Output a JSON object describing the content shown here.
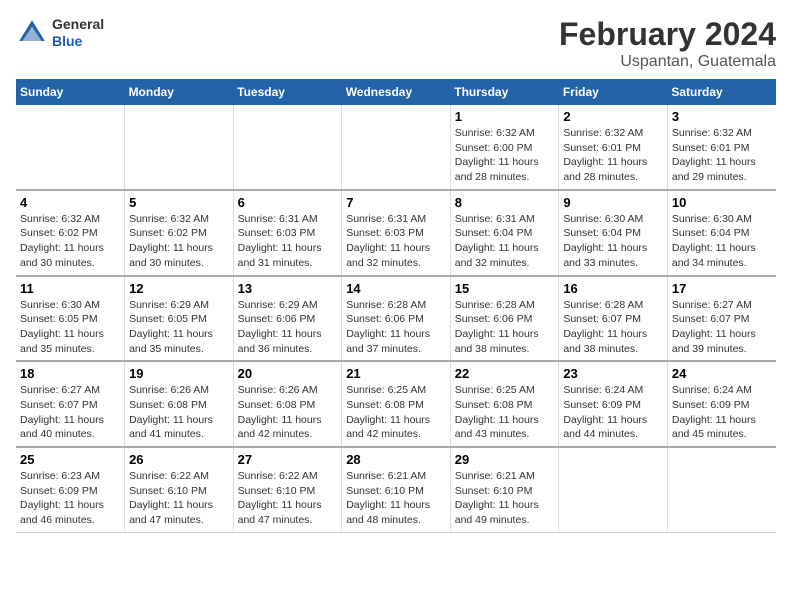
{
  "header": {
    "title": "February 2024",
    "subtitle": "Uspantan, Guatemala",
    "logo_general": "General",
    "logo_blue": "Blue"
  },
  "columns": [
    "Sunday",
    "Monday",
    "Tuesday",
    "Wednesday",
    "Thursday",
    "Friday",
    "Saturday"
  ],
  "weeks": [
    [
      {
        "day": "",
        "info": ""
      },
      {
        "day": "",
        "info": ""
      },
      {
        "day": "",
        "info": ""
      },
      {
        "day": "",
        "info": ""
      },
      {
        "day": "1",
        "info": "Sunrise: 6:32 AM\nSunset: 6:00 PM\nDaylight: 11 hours and 28 minutes."
      },
      {
        "day": "2",
        "info": "Sunrise: 6:32 AM\nSunset: 6:01 PM\nDaylight: 11 hours and 28 minutes."
      },
      {
        "day": "3",
        "info": "Sunrise: 6:32 AM\nSunset: 6:01 PM\nDaylight: 11 hours and 29 minutes."
      }
    ],
    [
      {
        "day": "4",
        "info": "Sunrise: 6:32 AM\nSunset: 6:02 PM\nDaylight: 11 hours and 30 minutes."
      },
      {
        "day": "5",
        "info": "Sunrise: 6:32 AM\nSunset: 6:02 PM\nDaylight: 11 hours and 30 minutes."
      },
      {
        "day": "6",
        "info": "Sunrise: 6:31 AM\nSunset: 6:03 PM\nDaylight: 11 hours and 31 minutes."
      },
      {
        "day": "7",
        "info": "Sunrise: 6:31 AM\nSunset: 6:03 PM\nDaylight: 11 hours and 32 minutes."
      },
      {
        "day": "8",
        "info": "Sunrise: 6:31 AM\nSunset: 6:04 PM\nDaylight: 11 hours and 32 minutes."
      },
      {
        "day": "9",
        "info": "Sunrise: 6:30 AM\nSunset: 6:04 PM\nDaylight: 11 hours and 33 minutes."
      },
      {
        "day": "10",
        "info": "Sunrise: 6:30 AM\nSunset: 6:04 PM\nDaylight: 11 hours and 34 minutes."
      }
    ],
    [
      {
        "day": "11",
        "info": "Sunrise: 6:30 AM\nSunset: 6:05 PM\nDaylight: 11 hours and 35 minutes."
      },
      {
        "day": "12",
        "info": "Sunrise: 6:29 AM\nSunset: 6:05 PM\nDaylight: 11 hours and 35 minutes."
      },
      {
        "day": "13",
        "info": "Sunrise: 6:29 AM\nSunset: 6:06 PM\nDaylight: 11 hours and 36 minutes."
      },
      {
        "day": "14",
        "info": "Sunrise: 6:28 AM\nSunset: 6:06 PM\nDaylight: 11 hours and 37 minutes."
      },
      {
        "day": "15",
        "info": "Sunrise: 6:28 AM\nSunset: 6:06 PM\nDaylight: 11 hours and 38 minutes."
      },
      {
        "day": "16",
        "info": "Sunrise: 6:28 AM\nSunset: 6:07 PM\nDaylight: 11 hours and 38 minutes."
      },
      {
        "day": "17",
        "info": "Sunrise: 6:27 AM\nSunset: 6:07 PM\nDaylight: 11 hours and 39 minutes."
      }
    ],
    [
      {
        "day": "18",
        "info": "Sunrise: 6:27 AM\nSunset: 6:07 PM\nDaylight: 11 hours and 40 minutes."
      },
      {
        "day": "19",
        "info": "Sunrise: 6:26 AM\nSunset: 6:08 PM\nDaylight: 11 hours and 41 minutes."
      },
      {
        "day": "20",
        "info": "Sunrise: 6:26 AM\nSunset: 6:08 PM\nDaylight: 11 hours and 42 minutes."
      },
      {
        "day": "21",
        "info": "Sunrise: 6:25 AM\nSunset: 6:08 PM\nDaylight: 11 hours and 42 minutes."
      },
      {
        "day": "22",
        "info": "Sunrise: 6:25 AM\nSunset: 6:08 PM\nDaylight: 11 hours and 43 minutes."
      },
      {
        "day": "23",
        "info": "Sunrise: 6:24 AM\nSunset: 6:09 PM\nDaylight: 11 hours and 44 minutes."
      },
      {
        "day": "24",
        "info": "Sunrise: 6:24 AM\nSunset: 6:09 PM\nDaylight: 11 hours and 45 minutes."
      }
    ],
    [
      {
        "day": "25",
        "info": "Sunrise: 6:23 AM\nSunset: 6:09 PM\nDaylight: 11 hours and 46 minutes."
      },
      {
        "day": "26",
        "info": "Sunrise: 6:22 AM\nSunset: 6:10 PM\nDaylight: 11 hours and 47 minutes."
      },
      {
        "day": "27",
        "info": "Sunrise: 6:22 AM\nSunset: 6:10 PM\nDaylight: 11 hours and 47 minutes."
      },
      {
        "day": "28",
        "info": "Sunrise: 6:21 AM\nSunset: 6:10 PM\nDaylight: 11 hours and 48 minutes."
      },
      {
        "day": "29",
        "info": "Sunrise: 6:21 AM\nSunset: 6:10 PM\nDaylight: 11 hours and 49 minutes."
      },
      {
        "day": "",
        "info": ""
      },
      {
        "day": "",
        "info": ""
      }
    ]
  ]
}
